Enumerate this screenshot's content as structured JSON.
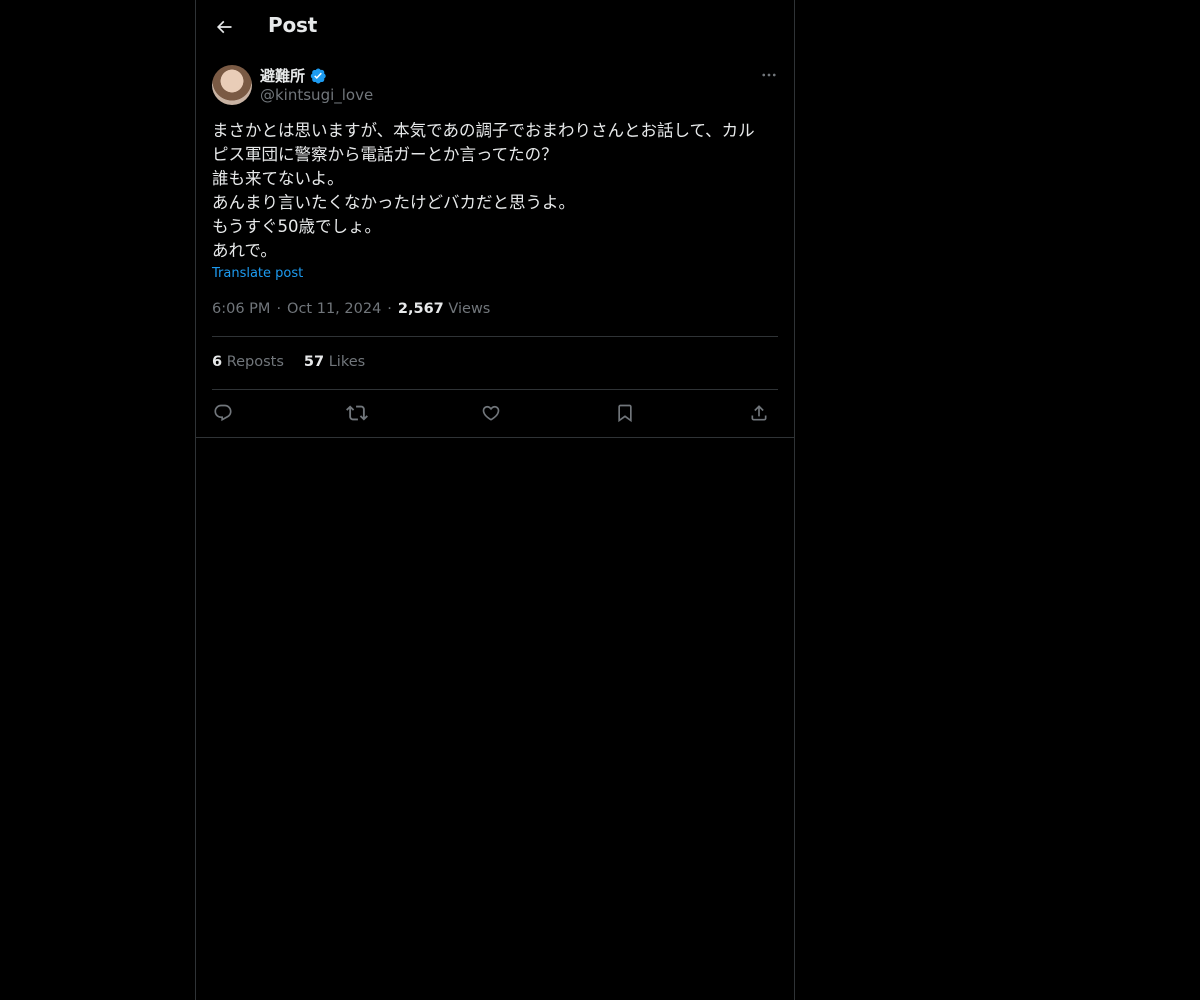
{
  "header": {
    "title": "Post",
    "back_icon": "arrow-left-icon"
  },
  "post": {
    "author": {
      "display_name": "避難所",
      "handle": "@kintsugi_love",
      "verified": true,
      "verified_color": "#1d9bf0"
    },
    "text_lines": [
      "まさかとは思いますが、本気であの調子でおまわりさんとお話して、カル",
      "ピス軍団に警察から電話ガーとか言ってたの？",
      "誰も来てないよ。",
      "あんまり言いたくなかったけどバカだと思うよ。",
      "もうすぐ50歳でしょ。",
      "あれで。"
    ],
    "translate_label": "Translate post",
    "time": "6:06 PM",
    "date": "Oct 11, 2024",
    "separator": "·",
    "views_count": "2,567",
    "views_label": "Views",
    "reposts_count": "6",
    "reposts_label": "Reposts",
    "likes_count": "57",
    "likes_label": "Likes"
  },
  "actions": {
    "reply": "reply-icon",
    "repost": "repost-icon",
    "like": "heart-icon",
    "bookmark": "bookmark-icon",
    "share": "share-icon"
  },
  "colors": {
    "background": "#000000",
    "text": "#e7e9ea",
    "muted": "#71767b",
    "border": "#2f3336",
    "accent": "#1d9bf0"
  }
}
